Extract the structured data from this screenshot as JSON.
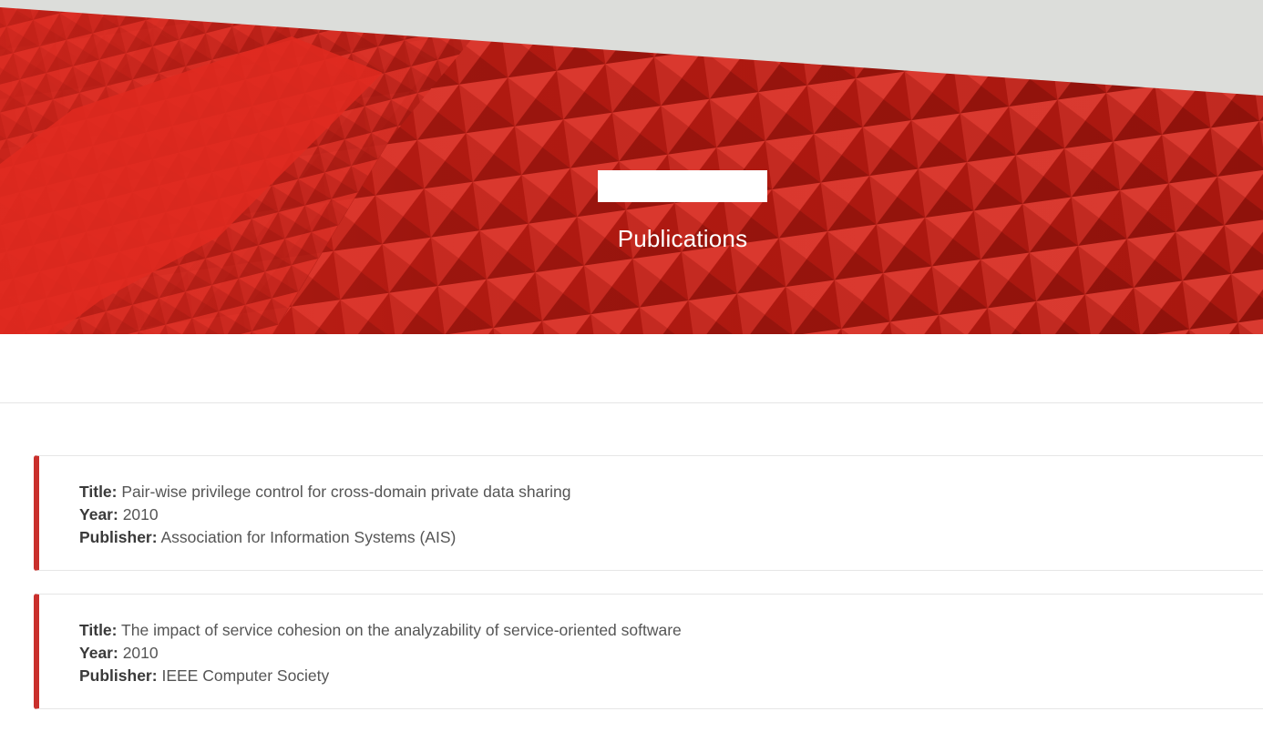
{
  "hero": {
    "title": "Publications",
    "colors": {
      "accent": "#c9302c",
      "hero_red": "#d42b22",
      "hero_gray": "#dcddda"
    }
  },
  "publications": [
    {
      "title_label": "Title:",
      "title": "Pair-wise privilege control for cross-domain private data sharing",
      "year_label": "Year:",
      "year": "2010",
      "publisher_label": "Publisher:",
      "publisher": "Association for Information Systems (AIS)"
    },
    {
      "title_label": "Title:",
      "title": "The impact of service cohesion on the analyzability of service-oriented software",
      "year_label": "Year:",
      "year": "2010",
      "publisher_label": "Publisher:",
      "publisher": "IEEE Computer Society"
    }
  ]
}
